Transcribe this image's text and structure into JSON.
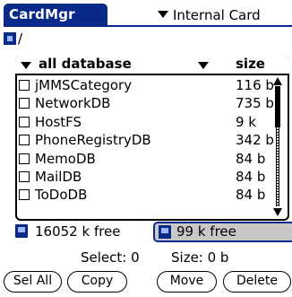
{
  "header": {
    "app_title": "CardMgr",
    "card_select": "Internal Card"
  },
  "path": "/",
  "list": {
    "column_name": "all database",
    "column_size": "size",
    "rows": [
      {
        "name": "jMMSCategory",
        "size": "116 b"
      },
      {
        "name": "NetworkDB",
        "size": "735 b"
      },
      {
        "name": "HostFS",
        "size": "9 k"
      },
      {
        "name": "PhoneRegistryDB",
        "size": "342 b"
      },
      {
        "name": "MemoDB",
        "size": "84 b"
      },
      {
        "name": "MailDB",
        "size": "84 b"
      },
      {
        "name": "ToDoDB",
        "size": "84 b"
      }
    ]
  },
  "free": {
    "internal": "16052 k free",
    "card": "99 k free"
  },
  "status": {
    "select": "Select: 0",
    "size": "Size: 0 b"
  },
  "buttons": {
    "sel_all": "Sel All",
    "copy": "Copy",
    "move": "Move",
    "delete": "Delete"
  }
}
